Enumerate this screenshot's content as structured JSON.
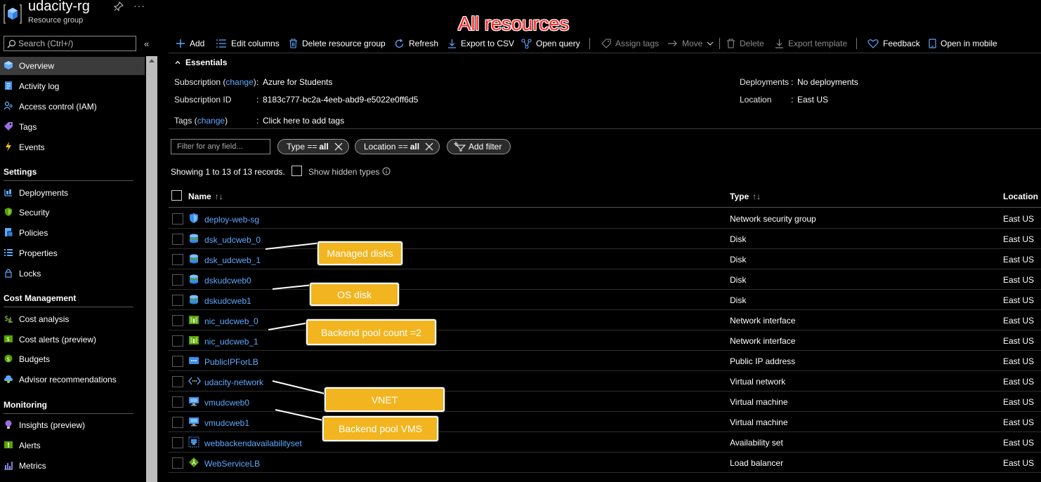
{
  "header": {
    "title": "udacity-rg",
    "subtitle": "Resource group",
    "page_heading": "All resources"
  },
  "sidebar": {
    "search_placeholder": "Search (Ctrl+/)",
    "collapse_glyph": "«",
    "items": [
      {
        "label": "Overview",
        "icon": "overview-icon",
        "active": true
      },
      {
        "label": "Activity log",
        "icon": "activity-log-icon"
      },
      {
        "label": "Access control (IAM)",
        "icon": "iam-icon"
      },
      {
        "label": "Tags",
        "icon": "tag-icon"
      },
      {
        "label": "Events",
        "icon": "lightning-icon"
      }
    ],
    "sections": [
      {
        "title": "Settings",
        "items": [
          {
            "label": "Deployments",
            "icon": "deployments-icon"
          },
          {
            "label": "Security",
            "icon": "shield-icon"
          },
          {
            "label": "Policies",
            "icon": "policies-icon"
          },
          {
            "label": "Properties",
            "icon": "properties-icon"
          },
          {
            "label": "Locks",
            "icon": "lock-icon"
          }
        ]
      },
      {
        "title": "Cost Management",
        "items": [
          {
            "label": "Cost analysis",
            "icon": "cost-analysis-icon"
          },
          {
            "label": "Cost alerts (preview)",
            "icon": "cost-alerts-icon"
          },
          {
            "label": "Budgets",
            "icon": "budgets-icon"
          },
          {
            "label": "Advisor recommendations",
            "icon": "advisor-icon"
          }
        ]
      },
      {
        "title": "Monitoring",
        "items": [
          {
            "label": "Insights (preview)",
            "icon": "insights-icon"
          },
          {
            "label": "Alerts",
            "icon": "alerts-icon"
          },
          {
            "label": "Metrics",
            "icon": "metrics-icon"
          }
        ]
      }
    ]
  },
  "toolbar": {
    "add": "Add",
    "edit_columns": "Edit columns",
    "delete_rg": "Delete resource group",
    "refresh": "Refresh",
    "export_csv": "Export to CSV",
    "open_query": "Open query",
    "assign_tags": "Assign tags",
    "move": "Move",
    "delete": "Delete",
    "export_template": "Export template",
    "feedback": "Feedback",
    "open_mobile": "Open in mobile"
  },
  "essentials": {
    "heading": "Essentials",
    "subscription_key": "Subscription (",
    "change": "change",
    "close_paren": ")",
    "subscription_value": "Azure for Students",
    "subscription_id_key": "Subscription ID",
    "subscription_id_value": "8183c777-bc2a-4eeb-abd9-e5022e0ff6d5",
    "tags_key": "Tags (",
    "tags_value": "Click here to add tags",
    "deployments_key": "Deployments",
    "deployments_value": "No deployments",
    "location_key": "Location",
    "location_value": "East US",
    "colon": ":"
  },
  "filters": {
    "placeholder": "Filter for any field...",
    "type_filter": {
      "prefix": "Type ==",
      "value": "all"
    },
    "location_filter": {
      "prefix": "Location ==",
      "value": "all"
    },
    "add_filter": "Add filter",
    "showing": "Showing 1 to 13 of 13 records.",
    "show_hidden": "Show hidden types"
  },
  "grid": {
    "columns": {
      "name": "Name",
      "type": "Type",
      "location": "Location"
    },
    "sort_glyph_name": "↑↓",
    "sort_glyph_type": "↑↓",
    "rows": [
      {
        "name": "deploy-web-sg",
        "type": "Network security group",
        "location": "East US",
        "icon": "nsg-shield-icon"
      },
      {
        "name": "dsk_udcweb_0",
        "type": "Disk",
        "location": "East US",
        "icon": "disk-icon"
      },
      {
        "name": "dsk_udcweb_1",
        "type": "Disk",
        "location": "East US",
        "icon": "disk-icon"
      },
      {
        "name": "dskudcweb0",
        "type": "Disk",
        "location": "East US",
        "icon": "disk-icon"
      },
      {
        "name": "dskudcweb1",
        "type": "Disk",
        "location": "East US",
        "icon": "disk-icon"
      },
      {
        "name": "nic_udcweb_0",
        "type": "Network interface",
        "location": "East US",
        "icon": "nic-icon"
      },
      {
        "name": "nic_udcweb_1",
        "type": "Network interface",
        "location": "East US",
        "icon": "nic-icon"
      },
      {
        "name": "PublicIPForLB",
        "type": "Public IP address",
        "location": "East US",
        "icon": "public-ip-icon"
      },
      {
        "name": "udacity-network",
        "type": "Virtual network",
        "location": "East US",
        "icon": "vnet-icon"
      },
      {
        "name": "vmudcweb0",
        "type": "Virtual machine",
        "location": "East US",
        "icon": "vm-icon"
      },
      {
        "name": "vmudcweb1",
        "type": "Virtual machine",
        "location": "East US",
        "icon": "vm-icon"
      },
      {
        "name": "webbackendavailabilityset",
        "type": "Availability set",
        "location": "East US",
        "icon": "availability-set-icon"
      },
      {
        "name": "WebServiceLB",
        "type": "Load balancer",
        "location": "East US",
        "icon": "load-balancer-icon"
      }
    ]
  },
  "annotations": {
    "managed_disks": "Managed disks",
    "os_disk": "OS disk",
    "backend_pool_count": "Backend pool count =2",
    "vnet": "VNET",
    "backend_pool_vms": "Backend pool VMS"
  },
  "colors": {
    "link": "#5ea9ff",
    "callout": "#f2b51f",
    "heading_red": "#ff2b2b",
    "background": "#000000"
  }
}
